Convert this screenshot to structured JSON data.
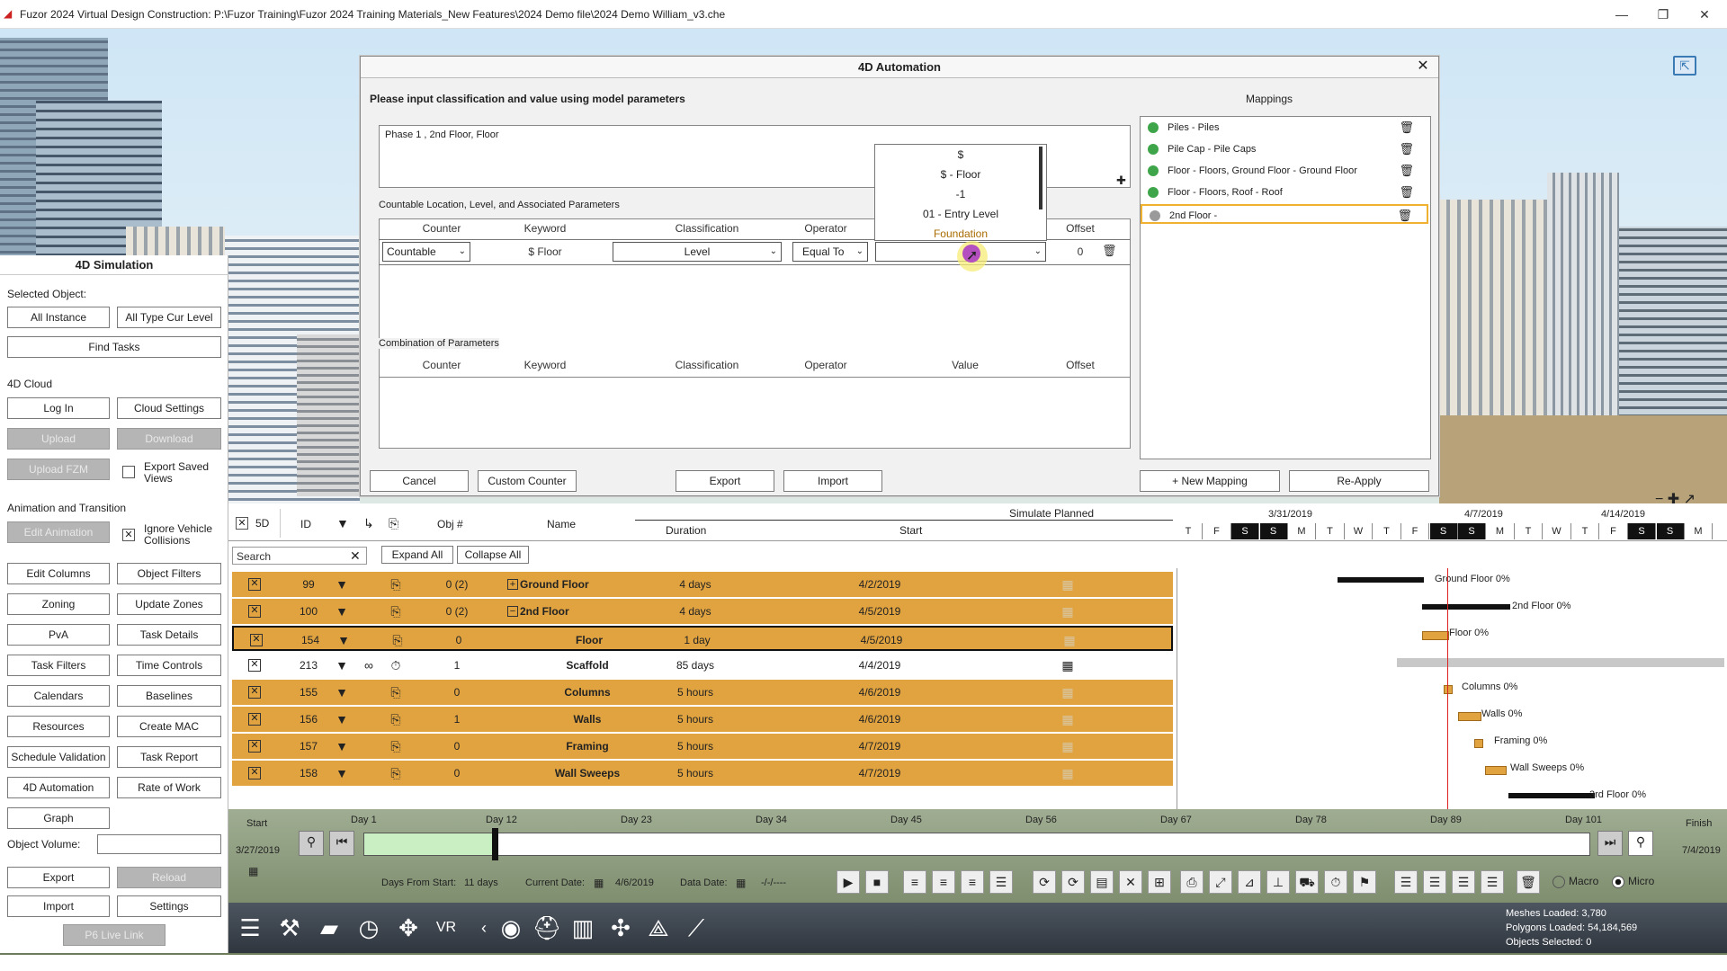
{
  "window": {
    "title": "Fuzor 2024 Virtual Design Construction: P:\\Fuzor Training\\Fuzor 2024 Training Materials_New Features\\2024 Demo file\\2024 Demo William_v3.che",
    "minimize": "—",
    "maximize": "❐",
    "close": "✕"
  },
  "sim": {
    "title": "4D Simulation",
    "selected_object_label": "Selected Object:",
    "all_instance": "All Instance",
    "all_type_cur_level": "All Type Cur Level",
    "find_tasks": "Find Tasks",
    "cloud_label": "4D Cloud",
    "log_in": "Log In",
    "cloud_settings": "Cloud Settings",
    "upload": "Upload",
    "download": "Download",
    "upload_fzm": "Upload FZM",
    "export_saved_views": "Export Saved Views",
    "anim_label": "Animation and Transition",
    "edit_animation": "Edit Animation",
    "ignore_vehicle": "Ignore Vehicle Collisions",
    "edit_columns": "Edit Columns",
    "object_filters": "Object Filters",
    "zoning": "Zoning",
    "update_zones": "Update Zones",
    "pva": "PvA",
    "task_details": "Task Details",
    "task_filters": "Task Filters",
    "time_controls": "Time Controls",
    "calendars": "Calendars",
    "baselines": "Baselines",
    "resources": "Resources",
    "create_mac": "Create MAC",
    "schedule_validation": "Schedule Validation",
    "task_report": "Task Report",
    "automation": "4D Automation",
    "rate_of_work": "Rate of Work",
    "graph": "Graph",
    "object_volume": "Object Volume:",
    "export": "Export",
    "reload": "Reload",
    "import": "Import",
    "settings": "Settings",
    "p6_live_link": "P6 Live Link"
  },
  "dialog": {
    "title": "4D Automation",
    "close": "✕",
    "instruction": "Please input classification and value using model parameters",
    "mappings_label": "Mappings",
    "text_value": "Phase 1 , 2nd Floor, Floor",
    "plus": "✚",
    "countable_label": "Countable Location, Level, and Associated Parameters",
    "headers": {
      "counter": "Counter",
      "keyword": "Keyword",
      "classification": "Classification",
      "operator": "Operator",
      "value": "Value",
      "offset": "Offset"
    },
    "row": {
      "counter": "Countable",
      "keyword": "$ Floor",
      "classification": "Level",
      "operator": "Equal To",
      "value": "",
      "offset": "0"
    },
    "dropdown_options": [
      "$",
      "$ - Floor",
      "-1",
      "01 - Entry Level",
      "Foundation"
    ],
    "combination_label": "Combination of Parameters",
    "cancel": "Cancel",
    "custom_counter": "Custom Counter",
    "export": "Export",
    "import": "Import",
    "new_mapping": "+ New Mapping",
    "re_apply": "Re-Apply",
    "mappings": [
      {
        "text": "Piles - Piles",
        "color": "#3fa54a"
      },
      {
        "text": "Pile Cap - Pile Caps",
        "color": "#3fa54a"
      },
      {
        "text": "Floor - Floors, Ground Floor - Ground Floor",
        "color": "#3fa54a"
      },
      {
        "text": "Floor - Floors, Roof - Roof",
        "color": "#3fa54a"
      },
      {
        "text": "2nd Floor -",
        "color": "#9a9a9a"
      }
    ]
  },
  "gantt": {
    "tab_5d": "5D",
    "col_id": "ID",
    "col_obj": "Obj #",
    "col_name": "Name",
    "col_duration": "Duration",
    "col_start": "Start",
    "simulate_planned": "Simulate Planned",
    "search_placeholder": "Search",
    "expand_all": "Expand All",
    "collapse_all": "Collapse All",
    "dates": [
      "3/31/2019",
      "4/7/2019",
      "4/14/2019"
    ],
    "weekdays": [
      "T",
      "F",
      "S",
      "S",
      "M",
      "T",
      "W",
      "T",
      "F",
      "S",
      "S",
      "M",
      "T",
      "W",
      "T",
      "F",
      "S",
      "S",
      "M"
    ],
    "rows": [
      {
        "id": "99",
        "obj": "0 (2)",
        "name": "Ground Floor",
        "duration": "4 days",
        "start": "4/2/2019",
        "orange": true,
        "expander": "+"
      },
      {
        "id": "100",
        "obj": "0 (2)",
        "name": "2nd Floor",
        "duration": "4 days",
        "start": "4/5/2019",
        "orange": true,
        "expander": "−"
      },
      {
        "id": "154",
        "obj": "0",
        "name": "Floor",
        "duration": "1 day",
        "start": "4/5/2019",
        "orange": true,
        "expander": ""
      },
      {
        "id": "213",
        "obj": "1",
        "name": "Scaffold",
        "duration": "85 days",
        "start": "4/4/2019",
        "orange": false,
        "expander": ""
      },
      {
        "id": "155",
        "obj": "0",
        "name": "Columns",
        "duration": "5 hours",
        "start": "4/6/2019",
        "orange": true,
        "expander": ""
      },
      {
        "id": "156",
        "obj": "1",
        "name": "Walls",
        "duration": "5 hours",
        "start": "4/6/2019",
        "orange": true,
        "expander": ""
      },
      {
        "id": "157",
        "obj": "0",
        "name": "Framing",
        "duration": "5 hours",
        "start": "4/7/2019",
        "orange": true,
        "expander": ""
      },
      {
        "id": "158",
        "obj": "0",
        "name": "Wall Sweeps",
        "duration": "5 hours",
        "start": "4/7/2019",
        "orange": true,
        "expander": ""
      }
    ],
    "chart_labels": [
      "Ground Floor   0%",
      "2nd Floor   0%",
      "Floor   0%",
      "Columns   0%",
      "Walls   0%",
      "Framing   0%",
      "Wall Sweeps   0%",
      "3rd Floor   0%"
    ]
  },
  "timeline": {
    "start_label": "Start",
    "start_date": "3/27/2019",
    "finish_label": "Finish",
    "finish_date": "7/4/2019",
    "days": [
      "Day 1",
      "Day 12",
      "Day 23",
      "Day 34",
      "Day 45",
      "Day 56",
      "Day 67",
      "Day 78",
      "Day 89",
      "Day 101"
    ],
    "days_from_start_label": "Days From Start:",
    "days_from_start": "11 days",
    "current_date_label": "Current Date:",
    "current_date": "4/6/2019",
    "data_date_label": "Data Date:",
    "data_date": "-/-/----",
    "macro": "Macro",
    "micro": "Micro"
  },
  "status": {
    "meshes": "Meshes Loaded: 3,780",
    "polygons": "Polygons Loaded: 54,184,569",
    "selected": "Objects Selected: 0"
  }
}
